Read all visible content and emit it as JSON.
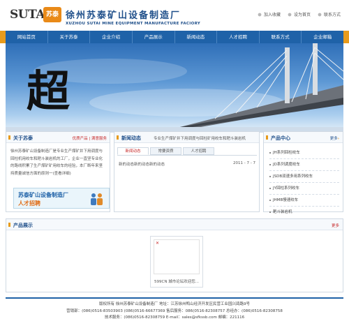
{
  "header": {
    "logo_latin": "SUTAi",
    "logo_seal": "苏泰",
    "company_cn": "徐州苏泰矿山设备制造厂",
    "company_en": "XUZHOU SUTAI MINE EQUIPMENT MANUFACTURE FACIORY",
    "top_links": [
      "加入收藏",
      "设为首页",
      "联系方式"
    ]
  },
  "nav": [
    "网站首页",
    "关于苏泰",
    "企业介绍",
    "产品展示",
    "新闻动态",
    "人才招聘",
    "联系方式",
    "企业邮箱"
  ],
  "banner": {
    "char": "超"
  },
  "about": {
    "title": "关于苏泰",
    "links": "优质产品 | 满意服务",
    "text": "徐州苏泰矿山设备制造厂是专业生产煤矿井下用调度与回柱机用绞车和耙斗装岩机的工厂，企业一直坚专业化的路线积累了生产煤矿矿用绞车的经验，本厂断年来坚持质量诚信方面的原则一(查看详细)",
    "recruit_line1": "苏泰矿山设备制造厂",
    "recruit_line2": "人才招聘"
  },
  "news": {
    "title": "新闻动态",
    "marquee": "专业生产煤矿井下用调度与回柱矿用绞车和耙斗装岩机",
    "tabs": [
      "新闻动态",
      "常要资质",
      "人才招聘"
    ],
    "active_tab": 0,
    "items": [
      {
        "title": "新的动态新的动态新的动态",
        "date": "2011 - 7 - 7"
      }
    ]
  },
  "products": {
    "title": "产品中心",
    "more": "更多",
    "items": [
      "JH系列回柱绞车",
      "JD系列调度绞车",
      "JSDB双速多用系列绞车",
      "JY回柱系列绞车",
      "JHMB慢速绞车",
      "耙斗装岩机"
    ]
  },
  "showcase": {
    "title": "产品展示",
    "more": "更多",
    "card_caption": "599CN 城市论坛欢迎您..."
  },
  "footer": {
    "line1": "版权所有 徐州苏泰矿山设备制造厂 地址：江苏徐州鸭山经济开发区民营工业园兴鸽路9号",
    "line2": "营销部：(086)0516-83503903  (086)0516-66677369 售后服务：086(0516-82308757 总经办：(086)0516-82308758",
    "line3": "技术服务：(086)0516-82308759 E-mail：sales@sfkssb.com 邮编：221116"
  }
}
